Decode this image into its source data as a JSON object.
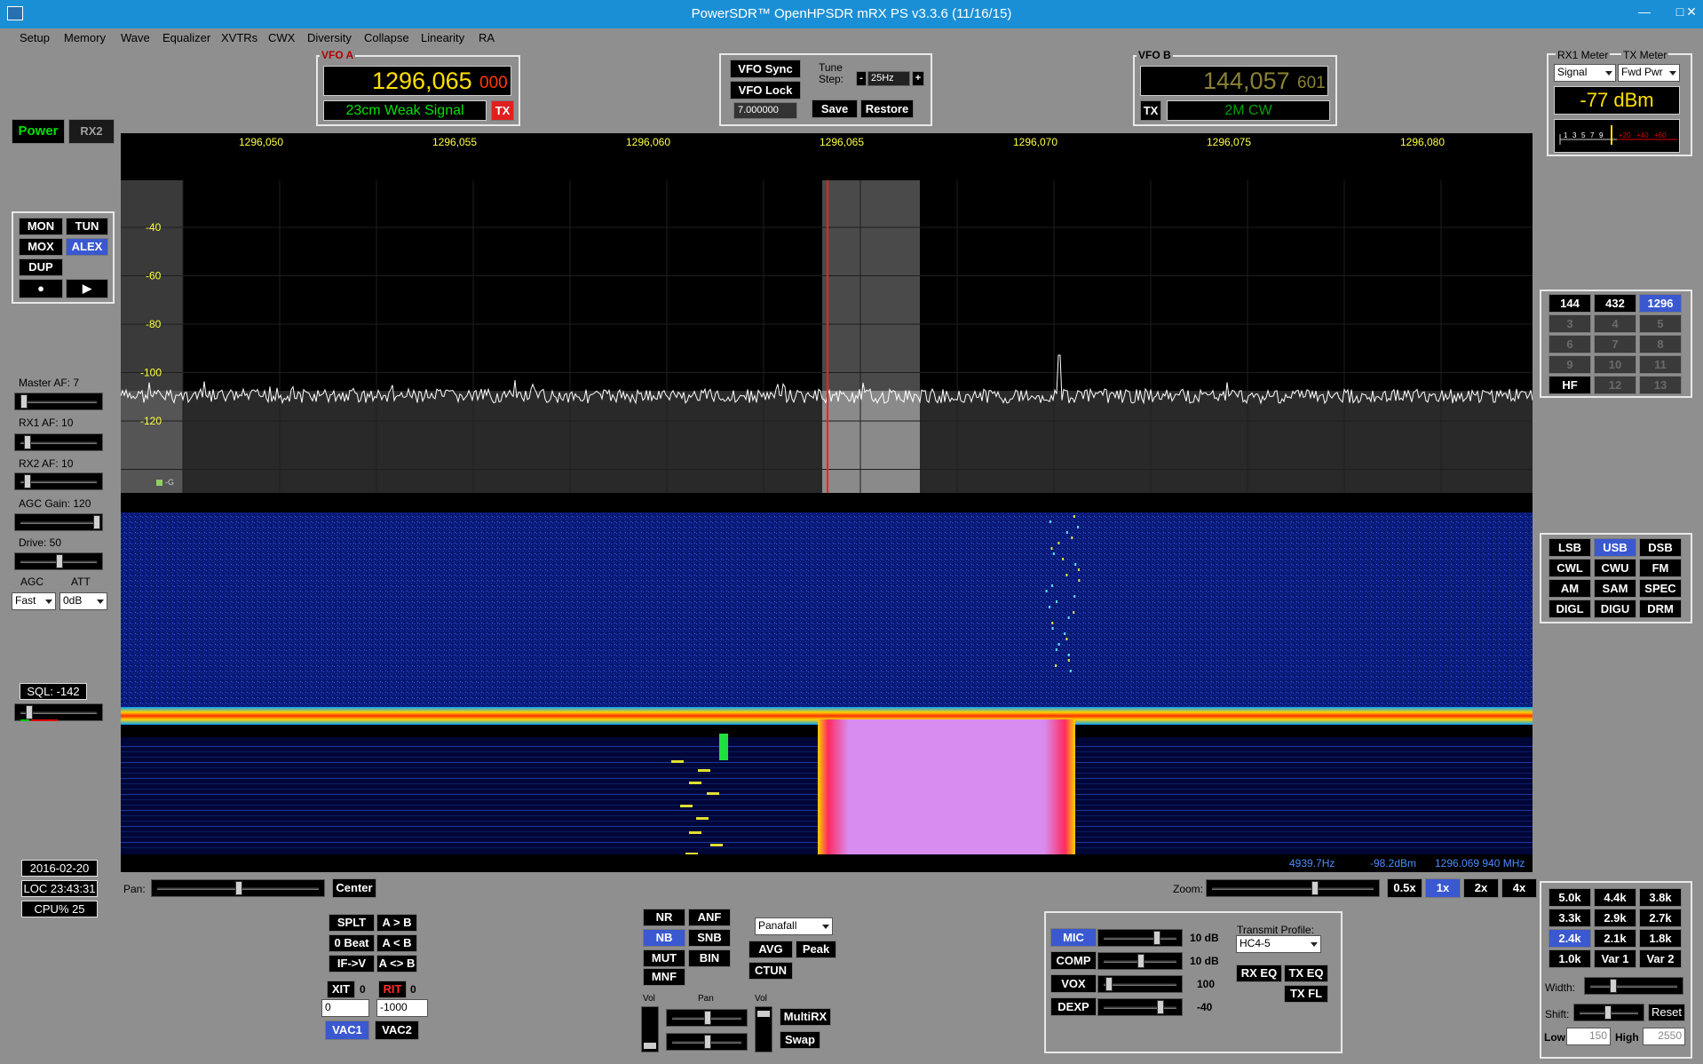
{
  "window": {
    "title": "PowerSDR™ OpenHPSDR mRX PS v3.3.6 (11/16/15)",
    "min": "—",
    "max": "□",
    "close": "✕"
  },
  "menu": [
    "Setup",
    "Memory",
    "Wave",
    "Equalizer",
    "XVTRs",
    "CWX",
    "Diversity",
    "Collapse",
    "Linearity",
    "RA"
  ],
  "power": {
    "power_label": "Power",
    "rx2_label": "RX2"
  },
  "vfoA": {
    "label": "VFO A",
    "freq_main": "1296,065",
    "freq_sub": "000",
    "band_text": "23cm Weak Signal",
    "tx_label": "TX"
  },
  "vfoB": {
    "label": "VFO B",
    "freq_main": "144,057",
    "freq_sub": "601",
    "band_text": "2M CW",
    "tx_label": "TX"
  },
  "vfo_ctrl": {
    "sync": "VFO Sync",
    "lock": "VFO Lock",
    "tune_step_label": "Tune Step:",
    "minus": "-",
    "step": "25Hz",
    "plus": "+",
    "freq_input": "7.000000",
    "save": "Save",
    "restore": "Restore"
  },
  "meter": {
    "rx1_label": "RX1 Meter",
    "tx_label": "TX Meter",
    "rx1_select": "Signal",
    "tx_select": "Fwd Pwr",
    "reading": "-77 dBm",
    "scale": [
      "1",
      "3",
      "5",
      "7",
      "9",
      "+20",
      "+40",
      "+60"
    ]
  },
  "mode_btns": {
    "mon": "MON",
    "tun": "TUN",
    "mox": "MOX",
    "alex": "ALEX",
    "dup": "DUP",
    "rec": "●",
    "play": "▶"
  },
  "sliders": {
    "master_af": "Master AF:  7",
    "rx1_af": "RX1 AF:  10",
    "rx2_af": "RX2 AF:  10",
    "agc_gain": "AGC Gain:  120",
    "drive": "Drive:  50",
    "agc_label": "AGC",
    "att_label": "ATT",
    "agc_value": "Fast",
    "att_value": "0dB",
    "sql": "SQL:  -142"
  },
  "status": {
    "date": "2016-02-20",
    "loc": "LOC 23:43:31",
    "cpu": "CPU%  25"
  },
  "spectrum": {
    "freq_labels": [
      "1296,050",
      "1296,055",
      "1296,060",
      "1296,065",
      "1296,070",
      "1296,075",
      "1296,080"
    ],
    "db_labels": [
      "-40",
      "-60",
      "-80",
      "-100",
      "-120"
    ],
    "marker_label": "-G",
    "readout_offset": "4939.7Hz",
    "readout_dbm": "-98.2dBm",
    "readout_freq": "1296.069 940 MHz"
  },
  "pan_zoom": {
    "pan_label": "Pan:",
    "center": "Center",
    "zoom_label": "Zoom:",
    "zooms": [
      "0.5x",
      "1x",
      "2x",
      "4x"
    ]
  },
  "bands": [
    "144",
    "432",
    "1296",
    "3",
    "4",
    "5",
    "6",
    "7",
    "8",
    "9",
    "10",
    "11",
    "HF",
    "12",
    "13"
  ],
  "modes": [
    "LSB",
    "USB",
    "DSB",
    "CWL",
    "CWU",
    "FM",
    "AM",
    "SAM",
    "SPEC",
    "DIGL",
    "DIGU",
    "DRM"
  ],
  "filters": [
    "5.0k",
    "4.4k",
    "3.8k",
    "3.3k",
    "2.9k",
    "2.7k",
    "2.4k",
    "2.1k",
    "1.8k",
    "1.0k",
    "Var 1",
    "Var 2"
  ],
  "filter_ctrl": {
    "width_label": "Width:",
    "shift_label": "Shift:",
    "reset": "Reset",
    "low_label": "Low",
    "low_value": "150",
    "high_label": "High",
    "high_value": "2550"
  },
  "split": {
    "splt": "SPLT",
    "a_to_b": "A > B",
    "zero_beat": "0 Beat",
    "b_to_a": "A < B",
    "if_v": "IF->V",
    "swap_ab": "A <> B",
    "xit": "XIT",
    "xit_val": "0",
    "rit": "RIT",
    "rit_val": "0",
    "xit_offset": "0",
    "rit_offset": "-1000",
    "vac1": "VAC1",
    "vac2": "VAC2"
  },
  "dsp": {
    "nr": "NR",
    "anf": "ANF",
    "nb": "NB",
    "snb": "SNB",
    "mut": "MUT",
    "bin": "BIN",
    "mnf": "MNF",
    "display_mode": "Panafall",
    "avg": "AVG",
    "peak": "Peak",
    "ctun": "CTUN",
    "vol_label": "Vol",
    "pan_label": "Pan",
    "vol2_label": "Vol",
    "multirx": "MultiRX",
    "swap": "Swap"
  },
  "tx": {
    "mic": "MIC",
    "mic_val": "10 dB",
    "comp": "COMP",
    "comp_val": "10 dB",
    "vox": "VOX",
    "vox_val": "100",
    "dexp": "DEXP",
    "dexp_val": "-40",
    "profile_label": "Transmit Profile:",
    "profile": "HC4-5",
    "rx_eq": "RX EQ",
    "tx_eq": "TX EQ",
    "tx_fl": "TX FL"
  },
  "colors": {
    "accent": "#3a58d0",
    "vfo_yellow": "#ffe000",
    "vfo_green": "#00e000",
    "title_blue": "#1b8fd6"
  }
}
